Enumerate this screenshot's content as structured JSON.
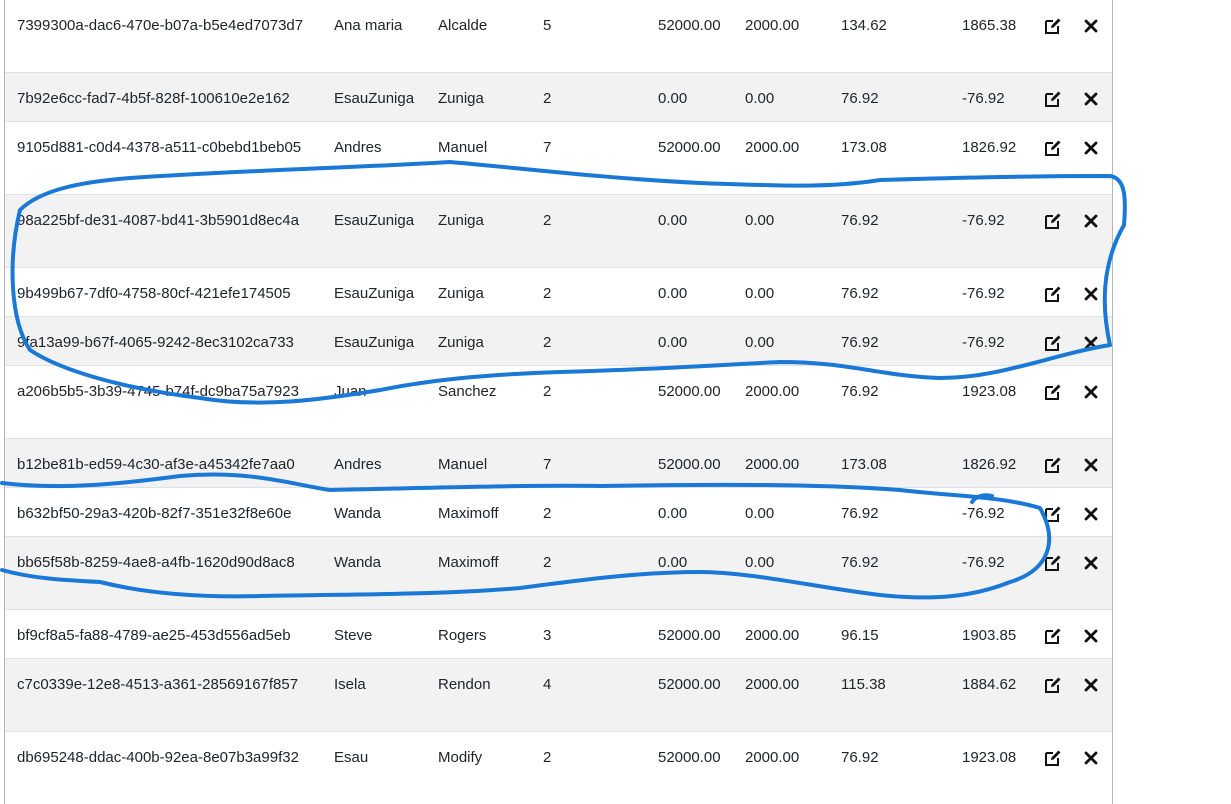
{
  "rows": [
    {
      "id": "7399300a-dac6-470e-b07a-b5e4ed7073d7",
      "first": "Ana maria",
      "last": "Alcalde",
      "n": "5",
      "gross": "52000.00",
      "deduction": "2000.00",
      "rate": "134.62",
      "net": "1865.38"
    },
    {
      "id": "7b92e6cc-fad7-4b5f-828f-100610e2e162",
      "first": "EsauZuniga",
      "last": "Zuniga",
      "n": "2",
      "gross": "0.00",
      "deduction": "0.00",
      "rate": "76.92",
      "net": "-76.92"
    },
    {
      "id": "9105d881-c0d4-4378-a511-c0bebd1beb05",
      "first": "Andres",
      "last": "Manuel",
      "n": "7",
      "gross": "52000.00",
      "deduction": "2000.00",
      "rate": "173.08",
      "net": "1826.92"
    },
    {
      "id": "98a225bf-de31-4087-bd41-3b5901d8ec4a",
      "first": "EsauZuniga",
      "last": "Zuniga",
      "n": "2",
      "gross": "0.00",
      "deduction": "0.00",
      "rate": "76.92",
      "net": "-76.92"
    },
    {
      "id": "9b499b67-7df0-4758-80cf-421efe174505",
      "first": "EsauZuniga",
      "last": "Zuniga",
      "n": "2",
      "gross": "0.00",
      "deduction": "0.00",
      "rate": "76.92",
      "net": "-76.92"
    },
    {
      "id": "9fa13a99-b67f-4065-9242-8ec3102ca733",
      "first": "EsauZuniga",
      "last": "Zuniga",
      "n": "2",
      "gross": "0.00",
      "deduction": "0.00",
      "rate": "76.92",
      "net": "-76.92"
    },
    {
      "id": "a206b5b5-3b39-4745-b74f-dc9ba75a7923",
      "first": "Juan",
      "last": "Sanchez",
      "n": "2",
      "gross": "52000.00",
      "deduction": "2000.00",
      "rate": "76.92",
      "net": "1923.08"
    },
    {
      "id": "b12be81b-ed59-4c30-af3e-a45342fe7aa0",
      "first": "Andres",
      "last": "Manuel",
      "n": "7",
      "gross": "52000.00",
      "deduction": "2000.00",
      "rate": "173.08",
      "net": "1826.92"
    },
    {
      "id": "b632bf50-29a3-420b-82f7-351e32f8e60e",
      "first": "Wanda",
      "last": "Maximoff",
      "n": "2",
      "gross": "0.00",
      "deduction": "0.00",
      "rate": "76.92",
      "net": "-76.92"
    },
    {
      "id": "bb65f58b-8259-4ae8-a4fb-1620d90d8ac8",
      "first": "Wanda",
      "last": "Maximoff",
      "n": "2",
      "gross": "0.00",
      "deduction": "0.00",
      "rate": "76.92",
      "net": "-76.92"
    },
    {
      "id": "bf9cf8a5-fa88-4789-ae25-453d556ad5eb",
      "first": "Steve",
      "last": "Rogers",
      "n": "3",
      "gross": "52000.00",
      "deduction": "2000.00",
      "rate": "96.15",
      "net": "1903.85"
    },
    {
      "id": "c7c0339e-12e8-4513-a361-28569167f857",
      "first": "Isela",
      "last": "Rendon",
      "n": "4",
      "gross": "52000.00",
      "deduction": "2000.00",
      "rate": "115.38",
      "net": "1884.62"
    },
    {
      "id": "db695248-ddac-400b-92ea-8e07b3a99f32",
      "first": "Esau",
      "last": "Modify",
      "n": "2",
      "gross": "52000.00",
      "deduction": "2000.00",
      "rate": "76.92",
      "net": "1923.08"
    }
  ],
  "icons": {
    "edit": "edit-icon",
    "delete": "close-icon"
  },
  "colors": {
    "row_stripe": "#f2f2f2",
    "annotation": "#1a78d6",
    "icon": "#111111"
  }
}
